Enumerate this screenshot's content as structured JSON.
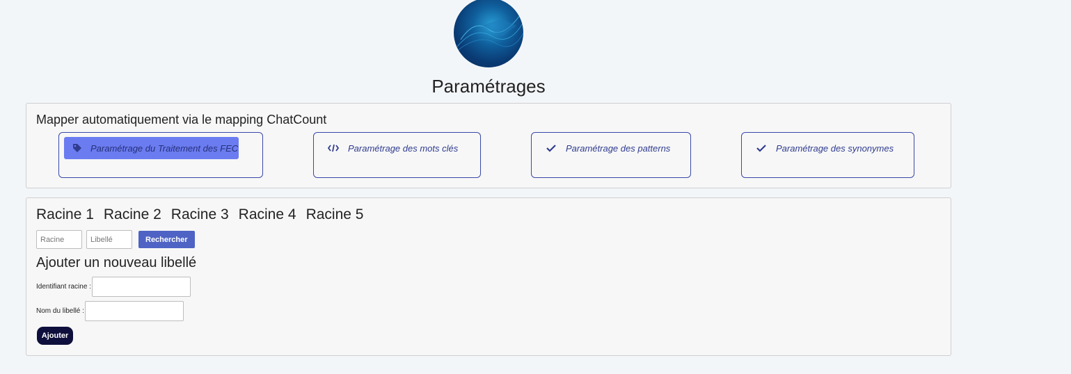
{
  "header": {
    "page_title": "Paramétrages"
  },
  "mapping": {
    "title": "Mapper automatiquement via le mapping ChatCount",
    "cards": [
      {
        "label": "Paramétrage du Traitement des FEC",
        "icon": "tag-icon",
        "active": true
      },
      {
        "label": "Paramétrage des mots clés",
        "icon": "code-icon",
        "active": false
      },
      {
        "label": "Paramétrage des patterns",
        "icon": "check-icon",
        "active": false
      },
      {
        "label": "Paramétrage des synonymes",
        "icon": "check-icon",
        "active": false
      }
    ]
  },
  "roots": {
    "tabs": [
      "Racine 1",
      "Racine 2",
      "Racine 3",
      "Racine 4",
      "Racine 5"
    ],
    "search": {
      "racine_placeholder": "Racine",
      "libelle_placeholder": "Libellé",
      "button_label": "Rechercher"
    },
    "add_form": {
      "title": "Ajouter un nouveau libellé",
      "id_label": "Identifiant racine :",
      "name_label": "Nom du libellé :",
      "submit_label": "Ajouter"
    }
  },
  "colors": {
    "accent": "#3848a8",
    "active_card": "#6b7cf0",
    "search_button": "#4e63c4",
    "add_button": "#0f0f3d"
  }
}
